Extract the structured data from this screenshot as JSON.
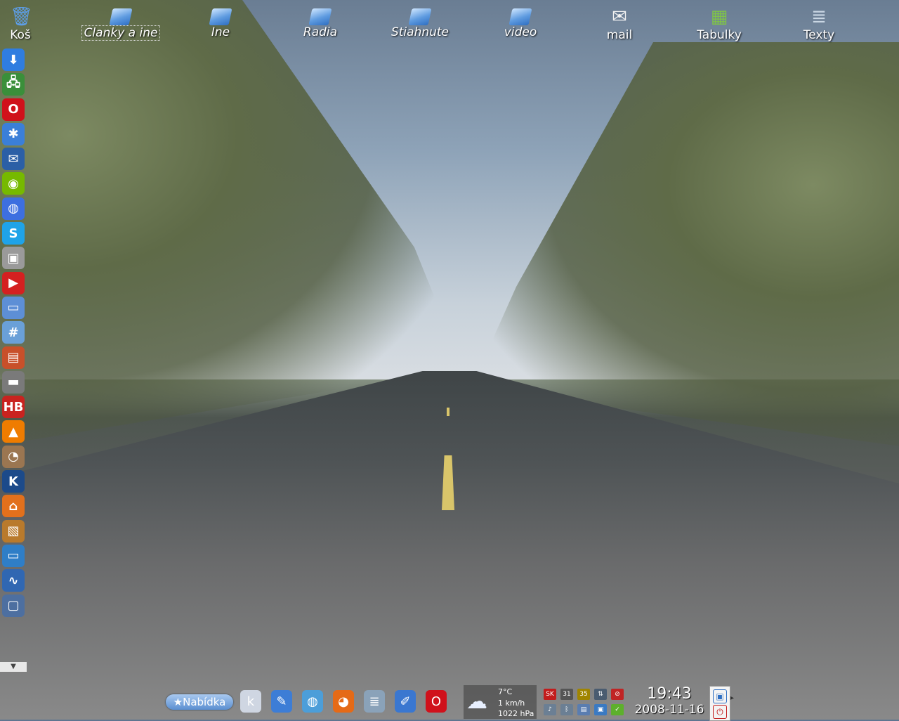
{
  "desktop": {
    "icons": [
      {
        "label": "Koš",
        "name": "trash-icon",
        "glyph": "🗑",
        "italic": false
      },
      {
        "label": "Clanky a ine",
        "name": "folder-icon",
        "glyph": "",
        "italic": true,
        "selected": true
      },
      {
        "label": "Ine",
        "name": "folder-icon",
        "glyph": "",
        "italic": true
      },
      {
        "label": "Radia",
        "name": "folder-icon",
        "glyph": "",
        "italic": true
      },
      {
        "label": "Stiahnute",
        "name": "folder-icon",
        "glyph": "",
        "italic": true
      },
      {
        "label": "video",
        "name": "folder-icon",
        "glyph": "",
        "italic": true
      },
      {
        "label": "mail",
        "name": "mail-icon",
        "glyph": "✉",
        "italic": false
      },
      {
        "label": "Tabulky",
        "name": "spreadsheet-icon",
        "glyph": "▦",
        "italic": false
      },
      {
        "label": "Texty",
        "name": "text-document-icon",
        "glyph": "≣",
        "italic": false
      }
    ]
  },
  "quick_launch": [
    {
      "name": "download-icon",
      "glyph": "⬇",
      "color": "#2f7de0"
    },
    {
      "name": "network-icon",
      "glyph": "🖧",
      "color": "#3a8f3a"
    },
    {
      "name": "opera-icon",
      "glyph": "O",
      "color": "#d0111b"
    },
    {
      "name": "gear-blue-icon",
      "glyph": "✱",
      "color": "#3b7fd8"
    },
    {
      "name": "thunderbird-icon",
      "glyph": "✉",
      "color": "#2b5fa6"
    },
    {
      "name": "nvidia-icon",
      "glyph": "◉",
      "color": "#76b900"
    },
    {
      "name": "globe-icon",
      "glyph": "◍",
      "color": "#3d6fe0"
    },
    {
      "name": "skype-icon",
      "glyph": "S",
      "color": "#1fa3e8"
    },
    {
      "name": "window-icon",
      "glyph": "▣",
      "color": "#9a9a9a"
    },
    {
      "name": "presentation-icon",
      "glyph": "▶",
      "color": "#d42020"
    },
    {
      "name": "display-settings-icon",
      "glyph": "▭",
      "color": "#5d8fd6"
    },
    {
      "name": "calculator-icon",
      "glyph": "#",
      "color": "#6aa0d8"
    },
    {
      "name": "firewall-icon",
      "glyph": "▤",
      "color": "#c8502a"
    },
    {
      "name": "drive-icon",
      "glyph": "▬",
      "color": "#7a7a7a"
    },
    {
      "name": "hb-icon",
      "glyph": "HB",
      "color": "#c9231f"
    },
    {
      "name": "vlc-icon",
      "glyph": "▲",
      "color": "#ef7c00"
    },
    {
      "name": "gopher-icon",
      "glyph": "◔",
      "color": "#9b7651"
    },
    {
      "name": "kde-icon",
      "glyph": "K",
      "color": "#1c4a8a"
    },
    {
      "name": "home-icon",
      "glyph": "⌂",
      "color": "#e2701c"
    },
    {
      "name": "package-install-icon",
      "glyph": "▧",
      "color": "#b97a2c"
    },
    {
      "name": "remote-desktop-icon",
      "glyph": "▭",
      "color": "#2f7ec7"
    },
    {
      "name": "system-monitor-icon",
      "glyph": "∿",
      "color": "#3067b2"
    },
    {
      "name": "screen-settings-icon",
      "glyph": "▢",
      "color": "#4d6fa0"
    }
  ],
  "panel": {
    "menu_label": "Nabídka",
    "launchers": [
      {
        "name": "kde-launcher-icon",
        "glyph": "k",
        "color": "#cfd6e2"
      },
      {
        "name": "kate-editor-icon",
        "glyph": "✎",
        "color": "#3d7dd6"
      },
      {
        "name": "konqueror-icon",
        "glyph": "◍",
        "color": "#4c9ed9"
      },
      {
        "name": "firefox-icon",
        "glyph": "◕",
        "color": "#e56a17"
      },
      {
        "name": "text-document-launcher-icon",
        "glyph": "≣",
        "color": "#8aa2b9"
      },
      {
        "name": "cleaner-icon",
        "glyph": "✐",
        "color": "#3a77d0"
      },
      {
        "name": "opera-launcher-icon",
        "glyph": "O",
        "color": "#d0111b"
      }
    ],
    "weather": {
      "temp": "7°C",
      "wind": "1 km/h",
      "pressure": "1022 hPa"
    },
    "tray": [
      {
        "name": "keyboard-layout-icon",
        "glyph": "SK",
        "color": "#c21c1c"
      },
      {
        "name": "calendar-icon",
        "glyph": "31",
        "color": "#555"
      },
      {
        "name": "temperature-icon",
        "glyph": "35",
        "color": "#a08500"
      },
      {
        "name": "network-tray-icon",
        "glyph": "⇅",
        "color": "#4a5c70"
      },
      {
        "name": "blocked-icon",
        "glyph": "⊘",
        "color": "#c02424"
      },
      {
        "name": "volume-icon",
        "glyph": "♪",
        "color": "#6b7f94"
      },
      {
        "name": "bluetooth-icon",
        "glyph": "ᛒ",
        "color": "#6b7f94"
      },
      {
        "name": "clipboard-icon",
        "glyph": "▤",
        "color": "#5a7db0"
      },
      {
        "name": "update-icon",
        "glyph": "▣",
        "color": "#3b7ac2"
      },
      {
        "name": "checkmark-icon",
        "glyph": "✓",
        "color": "#5db02c"
      }
    ],
    "clock": {
      "time": "19:43",
      "date": "2008-11-16"
    }
  }
}
